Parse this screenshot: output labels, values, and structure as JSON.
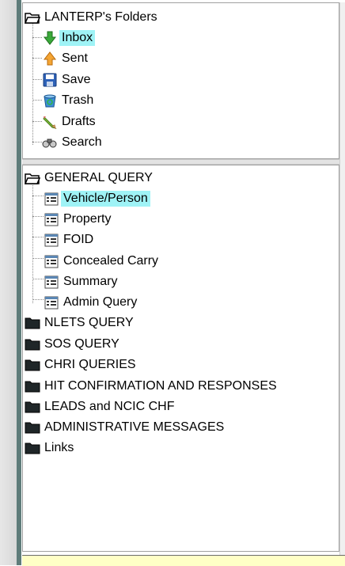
{
  "mail_tree": {
    "root_label": "LANTERP's Folders",
    "items": [
      {
        "label": "Inbox",
        "icon": "green-down-arrow-icon",
        "selected": true
      },
      {
        "label": "Sent",
        "icon": "orange-up-arrow-icon",
        "selected": false
      },
      {
        "label": "Save",
        "icon": "floppy-disk-icon",
        "selected": false
      },
      {
        "label": "Trash",
        "icon": "recycle-bin-icon",
        "selected": false
      },
      {
        "label": "Drafts",
        "icon": "pencil-icon",
        "selected": false
      },
      {
        "label": "Search",
        "icon": "binoculars-icon",
        "selected": false
      }
    ]
  },
  "query_tree": {
    "general": {
      "label": "GENERAL QUERY",
      "items": [
        {
          "label": "Vehicle/Person",
          "selected": true
        },
        {
          "label": "Property",
          "selected": false
        },
        {
          "label": "FOID",
          "selected": false
        },
        {
          "label": "Concealed Carry",
          "selected": false
        },
        {
          "label": "Summary",
          "selected": false
        },
        {
          "label": "Admin Query",
          "selected": false
        }
      ]
    },
    "folders": [
      "NLETS QUERY",
      "SOS QUERY",
      "CHRI QUERIES",
      "HIT CONFIRMATION AND RESPONSES",
      "LEADS and NCIC CHF",
      "ADMINISTRATIVE MESSAGES",
      "Links"
    ]
  },
  "colors": {
    "selection": "#9ff3f6",
    "status_bar": "#ffffc6",
    "folder_fill": "#1f2628",
    "left_bar": "#5f7c7a"
  }
}
